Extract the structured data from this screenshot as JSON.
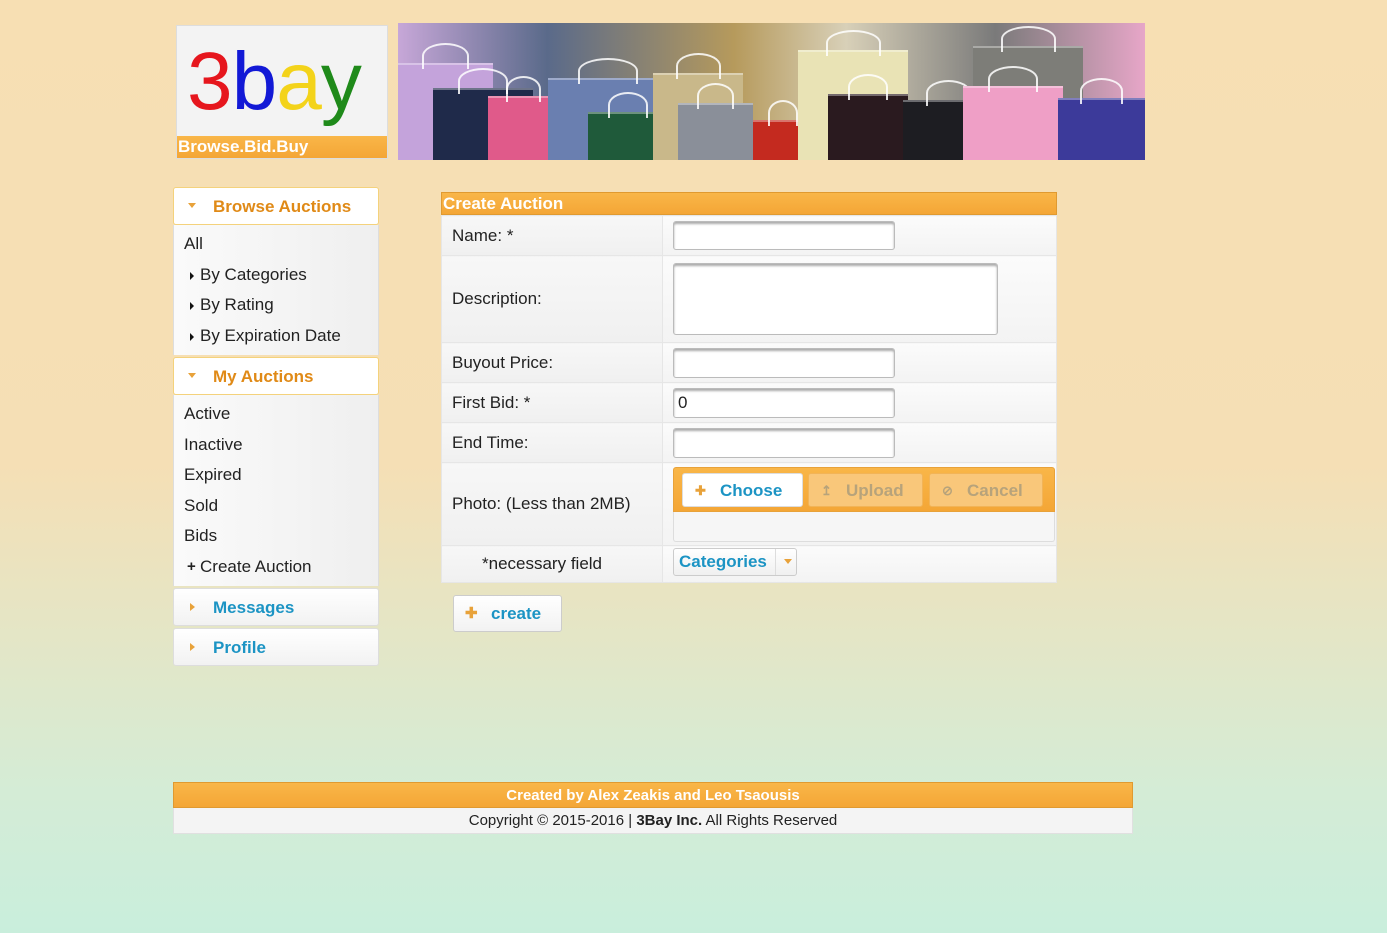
{
  "brand": {
    "logo_letters": [
      "3",
      "b",
      "a",
      "y"
    ],
    "logo_colors": [
      "#e6161d",
      "#1219d6",
      "#f3d31a",
      "#1f8a1a"
    ],
    "tagline": "Browse.Bid.Buy",
    "accent_color": "#f4a636",
    "link_color": "#1c94c4"
  },
  "sidebar": {
    "browse": {
      "title": "Browse Auctions",
      "items": [
        "All",
        "By Categories",
        "By Rating",
        "By Expiration Date"
      ]
    },
    "my_auctions": {
      "title": "My Auctions",
      "items": [
        "Active",
        "Inactive",
        "Expired",
        "Sold",
        "Bids",
        "Create Auction"
      ]
    },
    "messages": {
      "title": "Messages"
    },
    "profile": {
      "title": "Profile"
    }
  },
  "form": {
    "title": "Create Auction",
    "fields": {
      "name": {
        "label": "Name:",
        "required_mark": "*",
        "value": ""
      },
      "description": {
        "label": "Description:",
        "value": ""
      },
      "buyout": {
        "label": "Buyout Price:",
        "value": ""
      },
      "first_bid": {
        "label": "First Bid:",
        "required_mark": "*",
        "value": "0"
      },
      "end_time": {
        "label": "End Time:",
        "value": ""
      },
      "photo": {
        "label": "Photo: (Less than 2MB)",
        "choose": "Choose",
        "upload": "Upload",
        "cancel": "Cancel"
      }
    },
    "necessary_note": "*necessary field",
    "categories_button": "Categories",
    "create_button": "create"
  },
  "footer": {
    "credits": "Created by Alex Zeakis and Leo Tsaousis",
    "copyright_prefix": "Copyright © 2015-2016 |",
    "company": "3Bay Inc.",
    "rights": "All Rights Reserved"
  }
}
